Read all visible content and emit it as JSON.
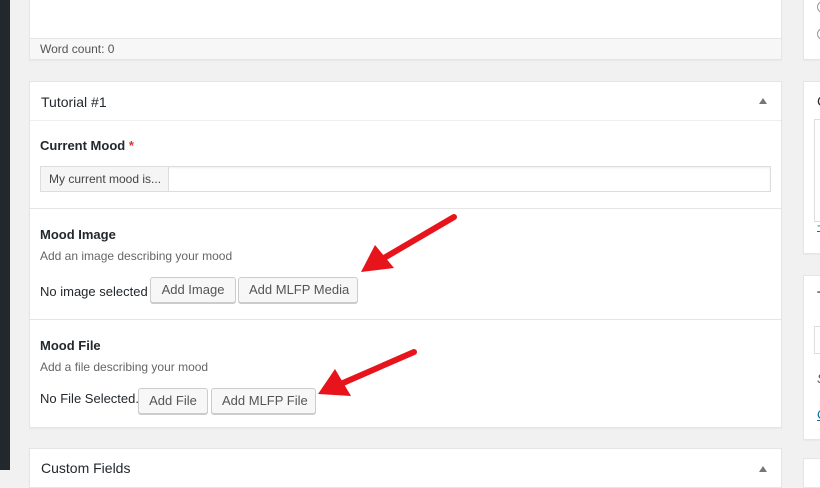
{
  "editor": {
    "word_count": "Word count: 0"
  },
  "tutorial": {
    "title": "Tutorial #1",
    "current_mood": {
      "label": "Current Mood",
      "required_mark": "*",
      "prefix": "My current mood is...",
      "value": ""
    },
    "mood_image": {
      "label": "Mood Image",
      "description": "Add an image describing your mood",
      "status": "No image selected",
      "add_button": "Add Image",
      "mlfp_button": "Add MLFP Media"
    },
    "mood_file": {
      "label": "Mood File",
      "description": "Add a file describing your mood",
      "status": "No File Selected.",
      "add_button": "Add File",
      "mlfp_button": "Add MLFP File"
    }
  },
  "custom_fields": {
    "title": "Custom Fields"
  },
  "sidebar": {
    "box2_title_initial": "C",
    "box2_link": "+",
    "box3_title_initial": "T",
    "box3_text": "S",
    "box3_link": "C"
  },
  "colors": {
    "annotation_arrow": "#e8141c",
    "required": "#dc3232",
    "link": "#0073aa"
  }
}
